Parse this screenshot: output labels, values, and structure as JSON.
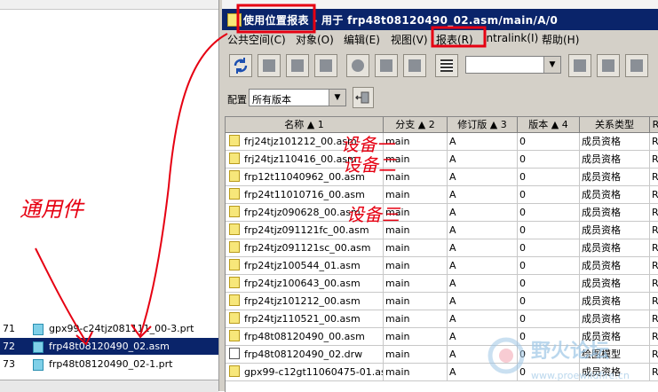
{
  "left_panel": {
    "rows": [
      {
        "num": "71",
        "name": "gpx99-c24tjz081111_00-3.prt",
        "selected": false
      },
      {
        "num": "72",
        "name": "frp48t08120490_02.asm",
        "selected": true
      },
      {
        "num": "73",
        "name": "frp48t08120490_02-1.prt",
        "selected": false
      }
    ]
  },
  "window": {
    "title": "使用位置报表 - 用于 frp48t08120490_02.asm/main/A/0",
    "menu": [
      {
        "label": "公共空间(C)"
      },
      {
        "label": "对象(O)"
      },
      {
        "label": "编辑(E)"
      },
      {
        "label": "视图(V)"
      },
      {
        "label": "报表(R)"
      },
      {
        "label": "Intralink(I)"
      },
      {
        "label": "帮助(H)"
      }
    ],
    "config_label": "配置",
    "config_value": "所有版本"
  },
  "table": {
    "columns": [
      {
        "label": "名称 ▲ 1"
      },
      {
        "label": "分支 ▲ 2"
      },
      {
        "label": "修订版 ▲ 3"
      },
      {
        "label": "版本 ▲ 4"
      },
      {
        "label": "关系类型"
      },
      {
        "label": "R"
      }
    ],
    "rows": [
      {
        "name": "frj24tjz101212_00.asm",
        "branch": "main",
        "revision": "A",
        "version": "0",
        "relation": "成员资格",
        "extra": "R",
        "icon": "asm"
      },
      {
        "name": "frj24tjz110416_00.asm",
        "branch": "main",
        "revision": "A",
        "version": "0",
        "relation": "成员资格",
        "extra": "R",
        "icon": "asm"
      },
      {
        "name": "frp12t11040962_00.asm",
        "branch": "main",
        "revision": "A",
        "version": "0",
        "relation": "成员资格",
        "extra": "R",
        "icon": "asm"
      },
      {
        "name": "frp24t11010716_00.asm",
        "branch": "main",
        "revision": "A",
        "version": "0",
        "relation": "成员资格",
        "extra": "R",
        "icon": "asm"
      },
      {
        "name": "frp24tjz090628_00.asm",
        "branch": "main",
        "revision": "A",
        "version": "0",
        "relation": "成员资格",
        "extra": "R",
        "icon": "asm"
      },
      {
        "name": "frp24tjz091121fc_00.asm",
        "branch": "main",
        "revision": "A",
        "version": "0",
        "relation": "成员资格",
        "extra": "R",
        "icon": "asm"
      },
      {
        "name": "frp24tjz091121sc_00.asm",
        "branch": "main",
        "revision": "A",
        "version": "0",
        "relation": "成员资格",
        "extra": "R",
        "icon": "asm"
      },
      {
        "name": "frp24tjz100544_01.asm",
        "branch": "main",
        "revision": "A",
        "version": "0",
        "relation": "成员资格",
        "extra": "R",
        "icon": "asm"
      },
      {
        "name": "frp24tjz100643_00.asm",
        "branch": "main",
        "revision": "A",
        "version": "0",
        "relation": "成员资格",
        "extra": "R",
        "icon": "asm"
      },
      {
        "name": "frp24tjz101212_00.asm",
        "branch": "main",
        "revision": "A",
        "version": "0",
        "relation": "成员资格",
        "extra": "R",
        "icon": "asm"
      },
      {
        "name": "frp24tjz110521_00.asm",
        "branch": "main",
        "revision": "A",
        "version": "0",
        "relation": "成员资格",
        "extra": "R",
        "icon": "asm"
      },
      {
        "name": "frp48t08120490_00.asm",
        "branch": "main",
        "revision": "A",
        "version": "0",
        "relation": "成员资格",
        "extra": "R",
        "icon": "asm"
      },
      {
        "name": "frp48t08120490_02.drw",
        "branch": "main",
        "revision": "A",
        "version": "0",
        "relation": "绘图模型",
        "extra": "R",
        "icon": "drw"
      },
      {
        "name": "gpx99-c12gt11060475-01.asm",
        "branch": "main",
        "revision": "A",
        "version": "0",
        "relation": "成员资格",
        "extra": "R",
        "icon": "asm"
      }
    ]
  },
  "annotations": {
    "common_part": "通用件",
    "device_one": "设备一",
    "device_two": "设备二",
    "device_three": "设备三"
  },
  "watermark": {
    "text": "野火论坛",
    "url": "www.proewildfire.cn"
  },
  "colors": {
    "selection": "#0a246a",
    "annotation": "#e60012",
    "chrome": "#d4d0c8"
  }
}
